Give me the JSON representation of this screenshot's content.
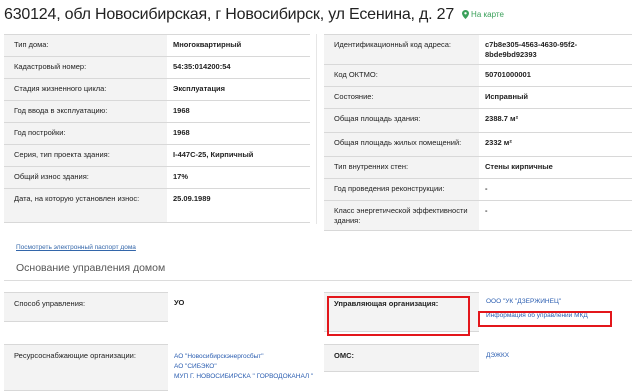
{
  "header": {
    "title": "630124, обл Новосибирская, г Новосибирск, ул Есенина, д. 27",
    "map_link": "На карте"
  },
  "left_table": [
    {
      "label": "Тип дома:",
      "value": "Многоквартирный"
    },
    {
      "label": "Кадастровый номер:",
      "value": "54:35:014200:54"
    },
    {
      "label": "Стадия жизненного цикла:",
      "value": "Эксплуатация"
    },
    {
      "label": "Год ввода в эксплуатацию:",
      "value": "1968"
    },
    {
      "label": "Год постройки:",
      "value": "1968"
    },
    {
      "label": "Серия, тип проекта здания:",
      "value": "I-447C-25, Кирпичный"
    },
    {
      "label": "Общий износ здания:",
      "value": "17%"
    },
    {
      "label": "Дата, на которую установлен износ:",
      "value": "25.09.1989"
    }
  ],
  "right_table": [
    {
      "label": "Идентификационный код адреса:",
      "value": "c7b8e305-4563-4630-95f2-8bde9bd92393"
    },
    {
      "label": "Код ОКТМО:",
      "value": "50701000001"
    },
    {
      "label": "Состояние:",
      "value": "Исправный"
    },
    {
      "label": "Общая площадь здания:",
      "value": "2388.7 м²"
    },
    {
      "label": "Общая площадь жилых помещений:",
      "value": "2332 м²"
    },
    {
      "label": "Тип внутренних стен:",
      "value": "Стены кирпичные"
    },
    {
      "label": "Год проведения реконструкции:",
      "value": "-"
    },
    {
      "label": "Класс энергетической эффективности здания:",
      "value": "-"
    }
  ],
  "passport_link": "Посмотреть электронный паспорт дома",
  "management": {
    "section_title": "Основание управления домом",
    "method_label": "Способ управления:",
    "method_value": "УО",
    "org_label": "Управляющая организация:",
    "org_name": "ООО \"УК \"ДЗЕРЖИНЕЦ\"",
    "org_info_link": "Информация об управлении МКД",
    "resource_label": "Ресурсоснабжающие организации:",
    "resource_orgs": [
      "АО \"Новосибирскэнергосбыт\"",
      "АО \"СИБЭКО\"",
      "МУП Г. НОВОСИБИРСКА \" ГОРВОДОКАНАЛ \""
    ],
    "oms_label": "ОМС:",
    "oms_value": "ДЭЖКХ"
  },
  "colors": {
    "accent_link": "#2a5db0",
    "map_green": "#3aa05a",
    "highlight_red": "#e3161b"
  }
}
